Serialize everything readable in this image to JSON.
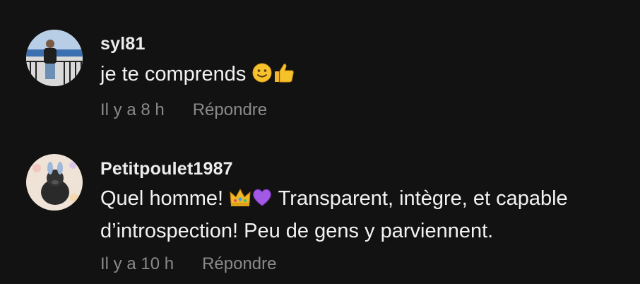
{
  "comments": [
    {
      "username": "syl81",
      "text": "je te comprends",
      "emojis": [
        "slightly-smiling-face-icon",
        "thumbs-up-icon"
      ],
      "time": "Il y a 8 h",
      "reply_label": "Répondre"
    },
    {
      "username": "Petitpoulet1987",
      "text_before_emoji": "Quel homme! ",
      "emojis": [
        "crown-icon",
        "purple-heart-icon"
      ],
      "text_after_emoji_line1": " Transparent, intègre, et capable",
      "text_line2": "d’introspection! Peu de gens y parviennent.",
      "time": "Il y a 10 h",
      "reply_label": "Répondre"
    }
  ],
  "colors": {
    "background": "#121212",
    "meta_text": "#8a8a8a",
    "primary_text": "#f2f2f2"
  }
}
